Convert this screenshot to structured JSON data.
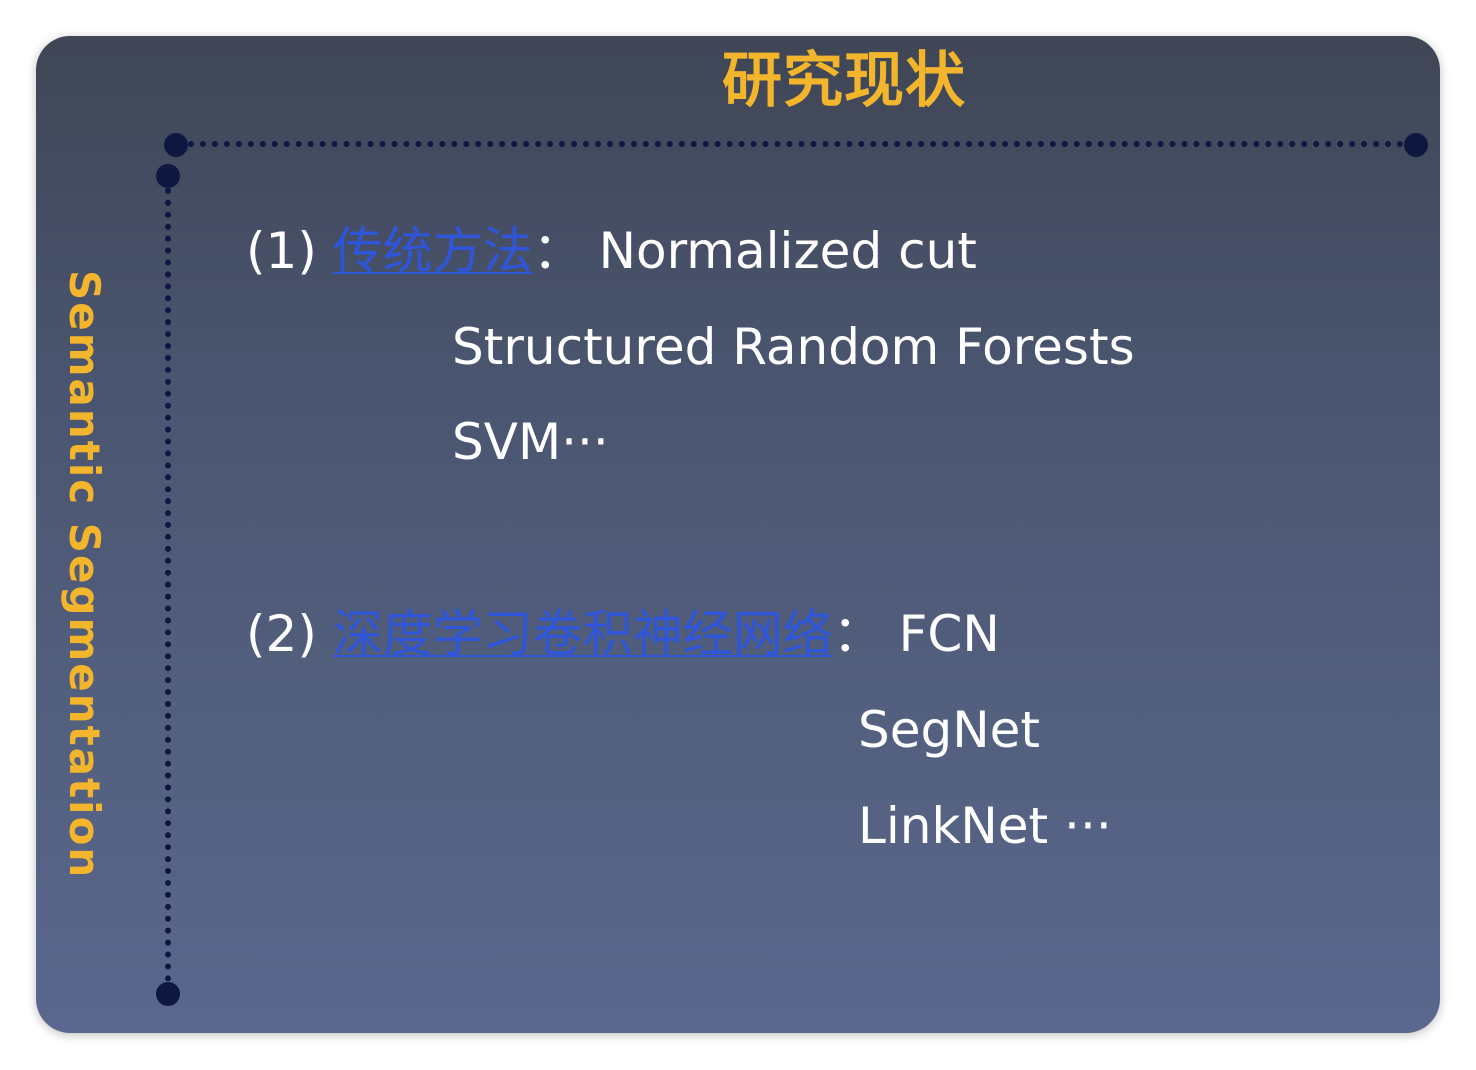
{
  "slide": {
    "title": "研究现状",
    "side_label": "Semantic Segmentation",
    "section1": {
      "number": "(1)",
      "link_text": "传统方法",
      "colon": "：",
      "items": [
        "Normalized cut",
        "Structured Random Forests",
        "SVM···"
      ]
    },
    "section2": {
      "number": "(2)",
      "link_text": "深度学习卷积神经网络",
      "colon": "：",
      "items": [
        "FCN",
        "SegNet",
        "LinkNet  ···"
      ]
    }
  },
  "colors": {
    "title": "#f3b52b",
    "link": "#2f56d8",
    "text": "#ffffff",
    "dots": "#0d1740"
  }
}
